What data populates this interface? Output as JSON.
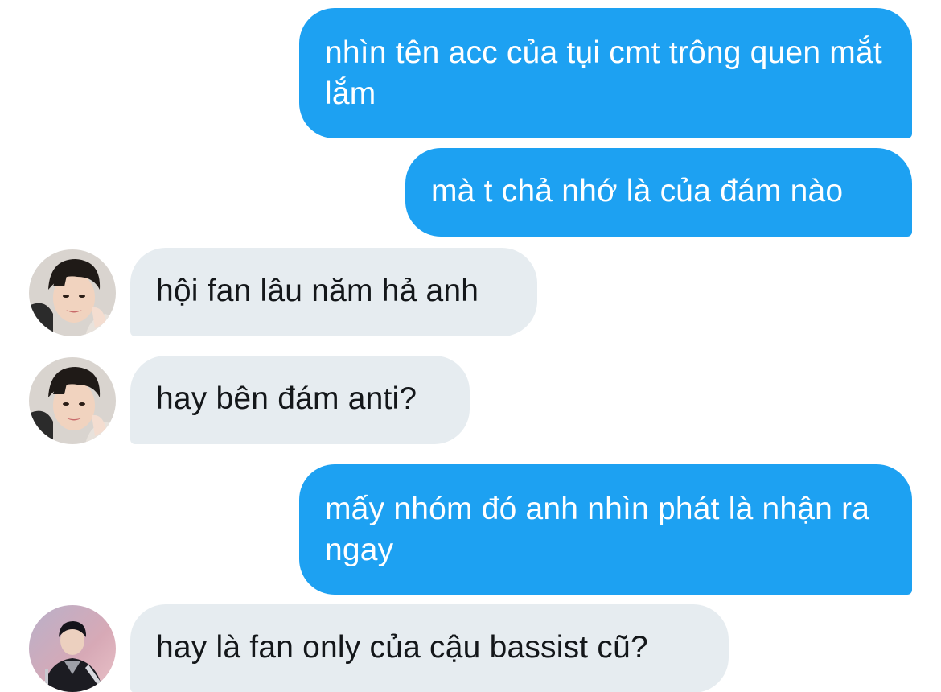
{
  "conversation": {
    "messages": [
      {
        "direction": "sent",
        "text": "nhìn tên acc của tụi cmt trông quen mắt lắm"
      },
      {
        "direction": "sent",
        "text": "mà t chả nhớ là của đám nào"
      },
      {
        "direction": "received",
        "text": "hội fan lâu năm hả anh",
        "avatar": "user-avatar-photo"
      },
      {
        "direction": "received",
        "text": "hay bên đám anti?",
        "avatar": "user-avatar-photo"
      },
      {
        "direction": "sent",
        "text": "mấy nhóm đó anh nhìn phát là nhận ra ngay"
      },
      {
        "direction": "received",
        "text": "hay là fan only của cậu bassist cũ?",
        "avatar": "user-avatar-photo-alt"
      }
    ]
  },
  "colors": {
    "sent_bubble": "#1da1f2",
    "received_bubble": "#e6ecf0",
    "received_text": "#14171a",
    "background": "#ffffff"
  }
}
